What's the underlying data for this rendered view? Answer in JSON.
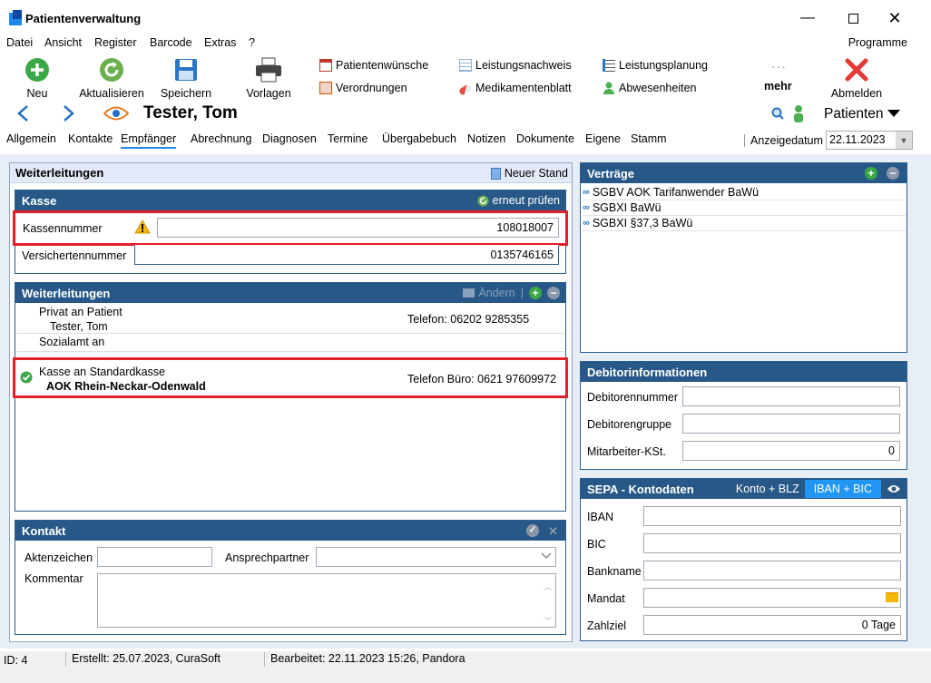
{
  "window": {
    "title": "Patientenverwaltung"
  },
  "menu": {
    "items": [
      "Datei",
      "Ansicht",
      "Register",
      "Barcode",
      "Extras",
      "?"
    ],
    "programme": "Programme"
  },
  "toolbar": {
    "neu": "Neu",
    "aktualisieren": "Aktualisieren",
    "speichern": "Speichern",
    "vorlagen": "Vorlagen",
    "patientenwuensche": "Patientenwünsche",
    "verordnungen": "Verordnungen",
    "leistungsnachweis": "Leistungsnachweis",
    "medikamentenblatt": "Medikamentenblatt",
    "leistungsplanung": "Leistungsplanung",
    "abwesenheiten": "Abwesenheiten",
    "mehr": "mehr",
    "abmelden": "Abmelden"
  },
  "nav": {
    "patient_name": "Tester, Tom",
    "patienten": "Patienten"
  },
  "tabs": [
    "Allgemein",
    "Kontakte",
    "Empfänger",
    "Abrechnung",
    "Diagnosen",
    "Termine",
    "Übergabebuch",
    "Notizen",
    "Dokumente",
    "Eigene",
    "Stamm"
  ],
  "anzeigedatum": {
    "label": "Anzeigedatum",
    "value": "22.11.2023"
  },
  "weiterleitungen_outer": {
    "title": "Weiterleitungen",
    "neuer_stand": "Neuer Stand"
  },
  "kasse": {
    "title": "Kasse",
    "erneut_pruefen": "erneut prüfen",
    "kassennummer_label": "Kassennummer",
    "kassennummer": "108018007",
    "versichertennummer_label": "Versichertennummer",
    "versichertennummer": "0135746165"
  },
  "weiterleitungen": {
    "title": "Weiterleitungen",
    "aendern": "Ändern",
    "rows": [
      {
        "line1": "Privat an Patient",
        "line2": "Tester, Tom",
        "phone": "Telefon: 06202 9285355"
      },
      {
        "line1": "Sozialamt an",
        "line2": "",
        "phone": ""
      },
      {
        "line1": "Kasse an Standardkasse",
        "line2": "AOK Rhein-Neckar-Odenwald",
        "phone": "Telefon Büro: 0621 97609972"
      }
    ]
  },
  "kontakt": {
    "title": "Kontakt",
    "aktenzeichen": "Aktenzeichen",
    "ansprechpartner": "Ansprechpartner",
    "kommentar": "Kommentar"
  },
  "vertraege": {
    "title": "Verträge",
    "items": [
      "SGBV AOK Tarifanwender BaWü",
      "SGBXI BaWü",
      "SGBXI §37,3 BaWü"
    ]
  },
  "debitor": {
    "title": "Debitorinformationen",
    "nummer": "Debitorennummer",
    "gruppe": "Debitorengruppe",
    "kst": "Mitarbeiter-KSt.",
    "kst_value": "0"
  },
  "sepa": {
    "title": "SEPA - Kontodaten",
    "konto_blz": "Konto + BLZ",
    "iban_bic": "IBAN + BIC",
    "iban": "IBAN",
    "bic": "BIC",
    "bankname": "Bankname",
    "mandat": "Mandat",
    "zahlziel": "Zahlziel",
    "zahlziel_value": "0 Tage"
  },
  "status": {
    "id": "ID: 4",
    "erstellt": "Erstellt: 25.07.2023, CuraSoft",
    "bearbeitet": "Bearbeitet: 22.11.2023 15:26, Pandora"
  },
  "colors": {
    "header_blue": "#275887",
    "accent_red": "#e0202a",
    "tab_underline": "#1e88e5",
    "add_green": "#3aa845"
  }
}
